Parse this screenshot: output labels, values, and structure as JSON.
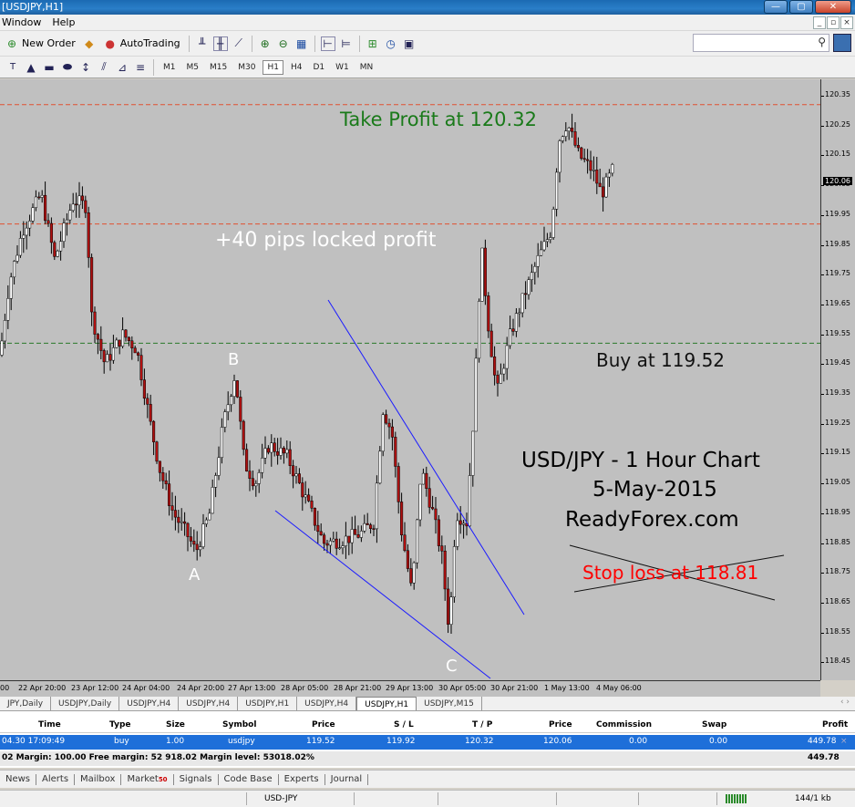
{
  "window": {
    "title": "[USDJPY,H1]",
    "buttons": [
      "—",
      "▢",
      "✕"
    ]
  },
  "menu": {
    "items": [
      "Window",
      "Help"
    ],
    "mdi_buttons": [
      "_",
      "▫",
      "×"
    ]
  },
  "toolbar": {
    "new_order_label": "New Order",
    "autotrading_label": "AutoTrading",
    "search_placeholder": ""
  },
  "timeframes": [
    "M1",
    "M5",
    "M15",
    "M30",
    "H1",
    "H4",
    "D1",
    "W1",
    "MN"
  ],
  "active_timeframe": "H1",
  "chart": {
    "symbol": "USDJPY",
    "period": "H1",
    "current_price_tag": "120.06",
    "y_ticks": [
      "120.35",
      "120.25",
      "120.15",
      "120.05",
      "119.95",
      "119.85",
      "119.75",
      "119.65",
      "119.55",
      "119.45",
      "119.35",
      "119.25",
      "119.15",
      "119.05",
      "118.95",
      "118.85",
      "118.75",
      "118.65",
      "118.55",
      "118.45"
    ],
    "x_ticks": [
      "00",
      "22 Apr 20:00",
      "23 Apr 12:00",
      "24 Apr 04:00",
      "24 Apr 20:00",
      "27 Apr 13:00",
      "28 Apr 05:00",
      "28 Apr 21:00",
      "29 Apr 13:00",
      "30 Apr 05:00",
      "30 Apr 21:00",
      "1 May 13:00",
      "4 May 06:00"
    ],
    "annotations": {
      "take_profit": "Take Profit at 120.32",
      "locked_profit": "+40 pips locked profit",
      "buy": "Buy at 119.52",
      "title_line1": "USD/JPY - 1 Hour Chart",
      "title_line2": "5-May-2015",
      "title_line3": "ReadyForex.com",
      "stop_loss": "Stop loss at 118.81",
      "point_a": "A",
      "point_b": "B",
      "point_c": "C"
    },
    "colors": {
      "background": "#c0c0c0",
      "take_profit_text": "#1a7a1a",
      "stop_loss_text": "#ff0000",
      "level_line_red": "#e05030",
      "level_line_green": "#2a7a2a",
      "candle_bull": "#ffffff",
      "candle_bear": "#b01010",
      "wedge_line": "#1a1aff"
    }
  },
  "chart_tabs": [
    "JPY,Daily",
    "USDJPY,Daily",
    "USDJPY,H4",
    "USDJPY,H4",
    "USDJPY,H1",
    "USDJPY,H4",
    "USDJPY,H1",
    "USDJPY,M15"
  ],
  "active_chart_tab_index": 6,
  "tab_nav": "‹  ›",
  "terminal": {
    "headers": [
      "Time",
      "Type",
      "Size",
      "Symbol",
      "Price",
      "S / L",
      "T / P",
      "Price",
      "Commission",
      "Swap",
      "Profit"
    ],
    "row": [
      "04.30 17:09:49",
      "buy",
      "1.00",
      "usdjpy",
      "119.52",
      "119.92",
      "120.32",
      "120.06",
      "0.00",
      "0.00",
      "449.78"
    ],
    "summary": "02  Margin: 100.00  Free margin: 52 918.02  Margin level: 53018.02%",
    "summary_profit": "449.78"
  },
  "bottom_tabs": [
    "News",
    "Alerts",
    "Mailbox",
    "Market",
    "Signals",
    "Code Base",
    "Experts",
    "Journal"
  ],
  "market_badge": "50",
  "status": {
    "profile": "USD-JPY",
    "traffic": "144/1 kb"
  }
}
